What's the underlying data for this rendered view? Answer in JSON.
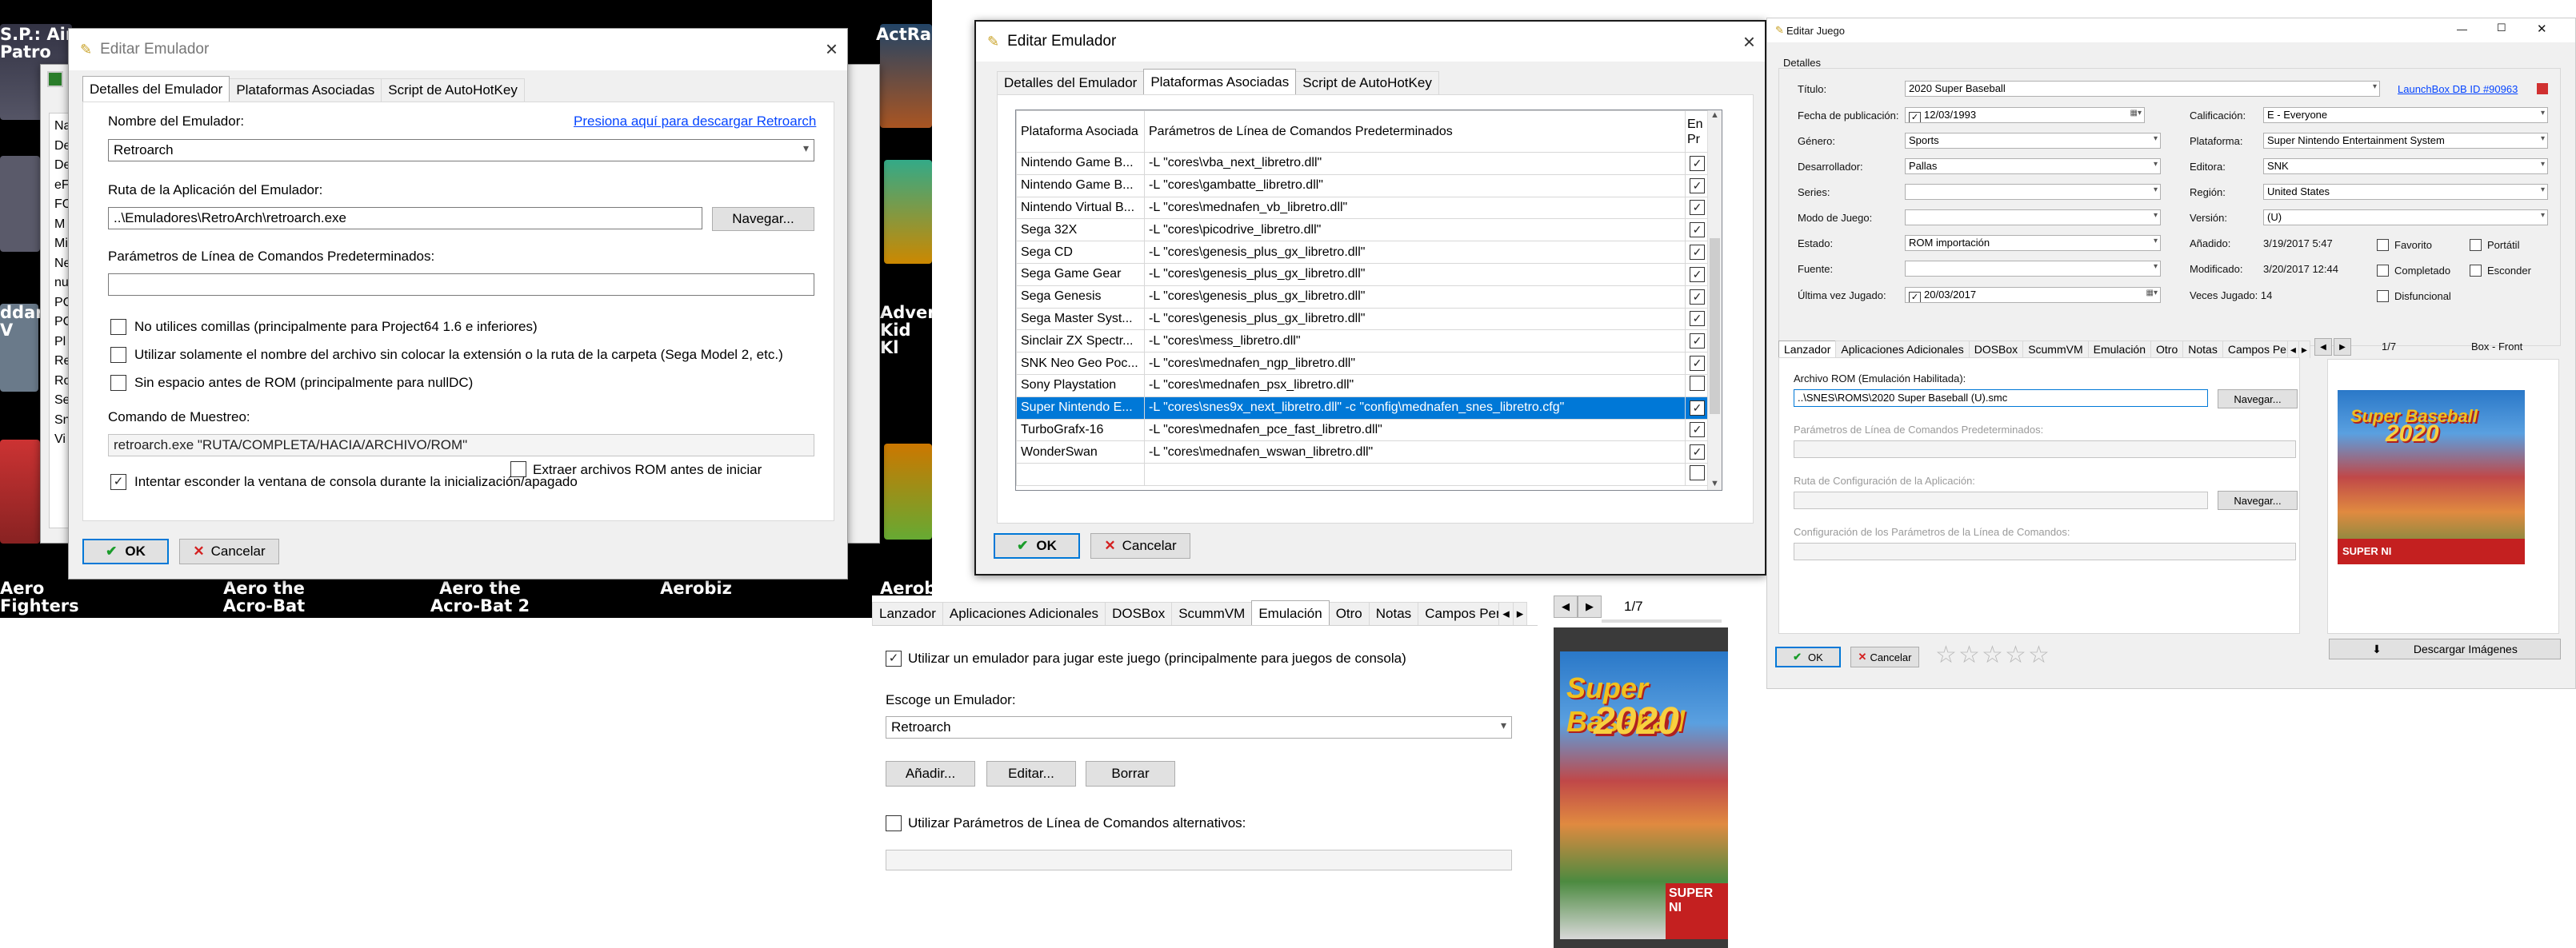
{
  "panel1": {
    "tiles": {
      "left": "S.P.: Air Patro",
      "right": "ActRais",
      "bottom_left_partial": "ddar V",
      "bottom_right_partial": "Adven Kid Kl",
      "captions": [
        "Aero Fighters",
        "Aero the Acro-Bat",
        "Aero the Acro-Bat 2",
        "Aerobiz",
        "Aerobi"
      ]
    },
    "backlist": [
      "Na",
      "De",
      "De",
      "eF",
      "FO",
      "M",
      "Mi",
      "Ne",
      "nu",
      "PC",
      "PC",
      "Pl",
      "Re",
      "Ro",
      "Se",
      "Sn",
      "Vi"
    ],
    "window": {
      "title": "Editar Emulador",
      "close": "×",
      "tabs": [
        "Detalles del Emulador",
        "Plataformas Asociadas",
        "Script de AutoHotKey"
      ],
      "name_label": "Nombre del Emulador:",
      "download_link": "Presiona aquí para descargar Retroarch",
      "name_value": "Retroarch",
      "path_label": "Ruta de la Aplicación del Emulador:",
      "path_value": "..\\Emuladores\\RetroArch\\retroarch.exe",
      "browse": "Navegar...",
      "params_label": "Parámetros de Línea de Comandos Predeterminados:",
      "params_value": "",
      "opt_no_quotes": "No utilices comillas (principalmente para Project64 1.6 e inferiores)",
      "opt_filename_only": "Utilizar solamente el nombre del archivo sin colocar la extensión o la ruta de la carpeta  (Sega Model 2, etc.)",
      "opt_no_space": "Sin espacio antes de ROM (principalmente para nullDC)",
      "sample_label": "Comando de Muestreo:",
      "sample_value": "retroarch.exe \"RUTA/COMPLETA/HACIA/ARCHIVO/ROM\"",
      "opt_extract": "Extraer archivos ROM antes de iniciar",
      "opt_hide_console": "Intentar esconder la ventana de consola durante la inicialización/apagado",
      "ok": "OK",
      "cancel": "Cancelar"
    }
  },
  "panel2": {
    "title": "Editar Emulador",
    "close": "×",
    "tabs": [
      "Detalles del Emulador",
      "Plataformas Asociadas",
      "Script de AutoHotKey"
    ],
    "columns": [
      "Plataforma Asociada",
      "Parámetros de Línea de Comandos Predeterminados",
      "En Pr"
    ],
    "rows": [
      {
        "platform": "Nintendo Game B...",
        "params": "-L \"cores\\vba_next_libretro.dll\"",
        "checked": true
      },
      {
        "platform": "Nintendo Game B...",
        "params": "-L \"cores\\gambatte_libretro.dll\"",
        "checked": true
      },
      {
        "platform": "Nintendo Virtual B...",
        "params": "-L \"cores\\mednafen_vb_libretro.dll\"",
        "checked": true
      },
      {
        "platform": "Sega 32X",
        "params": "-L \"cores\\picodrive_libretro.dll\"",
        "checked": true
      },
      {
        "platform": "Sega CD",
        "params": "-L \"cores\\genesis_plus_gx_libretro.dll\"",
        "checked": true
      },
      {
        "platform": "Sega Game Gear",
        "params": "-L \"cores\\genesis_plus_gx_libretro.dll\"",
        "checked": true
      },
      {
        "platform": "Sega Genesis",
        "params": "-L \"cores\\genesis_plus_gx_libretro.dll\"",
        "checked": true
      },
      {
        "platform": "Sega Master Syst...",
        "params": "-L \"cores\\genesis_plus_gx_libretro.dll\"",
        "checked": true
      },
      {
        "platform": "Sinclair ZX Spectr...",
        "params": "-L \"cores\\mess_libretro.dll\"",
        "checked": true
      },
      {
        "platform": "SNK Neo Geo Poc...",
        "params": "-L \"cores\\mednafen_ngp_libretro.dll\"",
        "checked": true
      },
      {
        "platform": "Sony Playstation",
        "params": "-L \"cores\\mednafen_psx_libretro.dll\"",
        "checked": false
      },
      {
        "platform": "Super Nintendo E...",
        "params": "-L \"cores\\snes9x_next_libretro.dll\" -c \"config\\mednafen_snes_libretro.cfg\"",
        "checked": true,
        "selected": true
      },
      {
        "platform": "TurboGrafx-16",
        "params": "-L \"cores\\mednafen_pce_fast_libretro.dll\"",
        "checked": true
      },
      {
        "platform": "WonderSwan",
        "params": "-L \"cores\\mednafen_wswan_libretro.dll\"",
        "checked": true
      },
      {
        "platform": "",
        "params": "",
        "checked": false
      }
    ],
    "ok": "OK",
    "cancel": "Cancelar"
  },
  "panel3": {
    "tabs": [
      "Lanzador",
      "Aplicaciones Adicionales",
      "DOSBox",
      "ScummVM",
      "Emulación",
      "Otro",
      "Notas",
      "Campos Perso"
    ],
    "use_emulator": "Utilizar un emulador para jugar este juego (principalmente para juegos de consola)",
    "choose_label": "Escoge un Emulador:",
    "emulator": "Retroarch",
    "add": "Añadir...",
    "edit": "Editar...",
    "delete": "Borrar",
    "alt_params": "Utilizar Parámetros de Línea de Comandos alternativos:",
    "page": "1/7",
    "box_title": "Super Baseball",
    "box_number": "2020",
    "box_brand": "SUPER NI"
  },
  "panel4": {
    "title": "Editar Juego",
    "section": "Detalles",
    "titulo_label": "Título:",
    "titulo": "2020 Super Baseball",
    "db_link": "LaunchBox DB ID #90963",
    "fecha_label": "Fecha de publicación:",
    "fecha": "12/03/1993",
    "calificacion_label": "Calificación:",
    "calificacion": "E - Everyone",
    "genero_label": "Género:",
    "genero": "Sports",
    "plataforma_label": "Plataforma:",
    "plataforma": "Super Nintendo Entertainment System",
    "desarrollador_label": "Desarrollador:",
    "desarrollador": "Pallas",
    "editora_label": "Editora:",
    "editora": "SNK",
    "series_label": "Series:",
    "series": "",
    "region_label": "Región:",
    "region": "United States",
    "modo_label": "Modo de Juego:",
    "modo": "",
    "version_label": "Versión:",
    "version": "(U)",
    "estado_label": "Estado:",
    "estado": "ROM importación",
    "anadido_label": "Añadido:",
    "anadido": "3/19/2017 5:47",
    "fuente_label": "Fuente:",
    "fuente": "",
    "modificado_label": "Modificado:",
    "modificado": "3/20/2017 12:44",
    "ultima_label": "Última vez Jugado:",
    "ultima": "20/03/2017",
    "veces": "Veces Jugado:  14",
    "favorito": "Favorito",
    "portatil": "Portátil",
    "completado": "Completado",
    "esconder": "Esconder",
    "disfuncional": "Disfuncional",
    "tabs": [
      "Lanzador",
      "Aplicaciones Adicionales",
      "DOSBox",
      "ScummVM",
      "Emulación",
      "Otro",
      "Notas",
      "Campos Perso"
    ],
    "rom_label": "Archivo ROM (Emulación Habilitada):",
    "rom": "..\\SNES\\ROMS\\2020 Super Baseball (U).smc",
    "browse": "Navegar...",
    "params_label": "Parámetros de Línea de Comandos Predeterminados:",
    "config_label": "Ruta de Configuración de la Aplicación:",
    "config_params_label": "Configuración de los Parámetros de la Línea de Comandos:",
    "page": "1/7",
    "image_type": "Box - Front",
    "download_images": "Descargar Imágenes",
    "ok": "OK",
    "cancel": "Cancelar",
    "rating": 0
  },
  "colors": {
    "selection": "#0078d7",
    "link": "#0645ff",
    "panel_bg": "#f0f0f0"
  }
}
